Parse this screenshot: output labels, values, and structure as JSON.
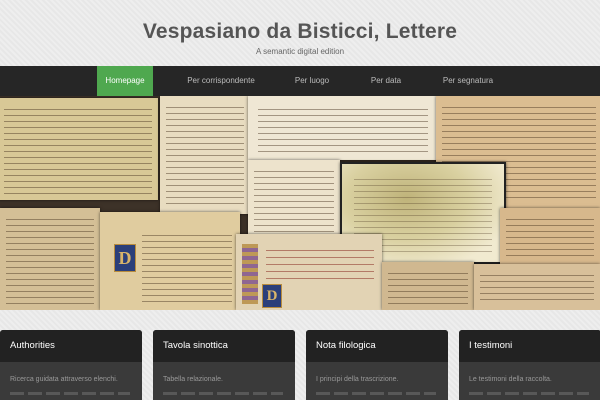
{
  "site": {
    "title": "Vespasiano da Bisticci, Lettere",
    "subtitle": "A semantic digital edition"
  },
  "nav": {
    "items": [
      {
        "label": "Homepage",
        "active": true
      },
      {
        "label": "Per corrispondente",
        "active": false
      },
      {
        "label": "Per luogo",
        "active": false
      },
      {
        "label": "Per data",
        "active": false
      },
      {
        "label": "Per segnatura",
        "active": false
      }
    ],
    "active_color": "#4fa84f"
  },
  "banner": {
    "description": "collage of manuscript letters",
    "initials": [
      "D",
      "D"
    ],
    "rubric_text": "Vespasiano da Bisticci manuscript pages"
  },
  "cards": [
    {
      "title": "Authorities",
      "text": "Ricerca guidata attraverso elenchi."
    },
    {
      "title": "Tavola sinottica",
      "text": "Tabella relazionale."
    },
    {
      "title": "Nota filologica",
      "text": "I principi della trascrizione."
    },
    {
      "title": "I testimoni",
      "text": "Le testimoni della raccolta."
    }
  ]
}
